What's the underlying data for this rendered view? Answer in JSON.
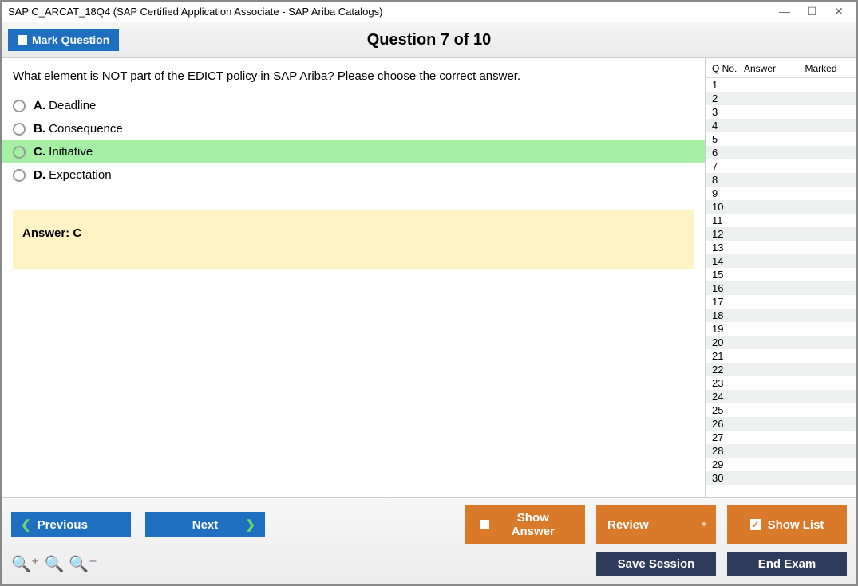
{
  "window": {
    "title": "SAP C_ARCAT_18Q4 (SAP Certified Application Associate - SAP Ariba Catalogs)"
  },
  "header": {
    "mark_label": "Mark Question",
    "question_title": "Question 7 of 10"
  },
  "question": {
    "text": "What element is NOT part of the EDICT policy in SAP Ariba? Please choose the correct answer.",
    "options": [
      {
        "letter": "A.",
        "label": "Deadline",
        "correct": false
      },
      {
        "letter": "B.",
        "label": "Consequence",
        "correct": false
      },
      {
        "letter": "C.",
        "label": "Initiative",
        "correct": true
      },
      {
        "letter": "D.",
        "label": "Expectation",
        "correct": false
      }
    ],
    "answer_label_prefix": "Answer: ",
    "answer": "C"
  },
  "sidebar": {
    "col_qno": "Q No.",
    "col_answer": "Answer",
    "col_marked": "Marked",
    "row_count": 30
  },
  "footer": {
    "previous": "Previous",
    "next": "Next",
    "show_answer": "Show Answer",
    "review": "Review",
    "show_list": "Show List",
    "save_session": "Save Session",
    "end_exam": "End Exam"
  }
}
